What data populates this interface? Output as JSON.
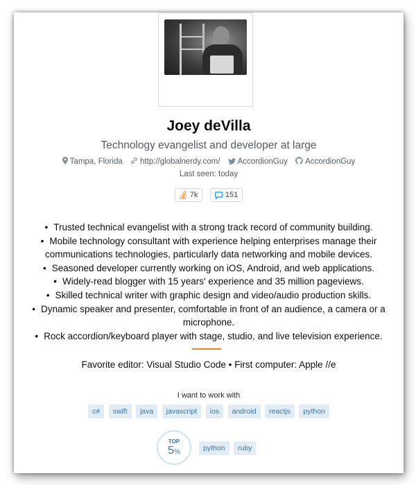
{
  "profile": {
    "name": "Joey deVilla",
    "tagline": "Technology evangelist and developer at large",
    "location": "Tampa, Florida",
    "website": "http://globalnerdy.com/",
    "twitter": "AccordionGuy",
    "github": "AccordionGuy",
    "last_seen": "Last seen: today"
  },
  "stats": {
    "reputation": "7k",
    "answers": "151"
  },
  "bullets": [
    "Trusted technical evangelist with a strong track record of community building.",
    "Mobile technology consultant with experience helping enterprises manage their communications technologies, particularly data networking and mobile devices.",
    "Seasoned developer currently working on iOS, Android, and web applications.",
    "Widely-read blogger with 15 years' experience and 35 million pageviews.",
    "Skilled technical writer with graphic design and video/audio production skills.",
    "Dynamic speaker and presenter, comfortable in front of an audience, a camera or a microphone.",
    "Rock accordion/keyboard player with stage, studio, and live television experience."
  ],
  "favorites": "Favorite editor: Visual Studio Code • First computer: Apple //e",
  "work": {
    "label": "I want to work with",
    "tags": [
      "c#",
      "swift",
      "java",
      "javascript",
      "ios",
      "android",
      "reactjs",
      "python"
    ]
  },
  "top": {
    "label": "TOP",
    "value": "5",
    "unit": "%",
    "tags": [
      "python",
      "ruby"
    ]
  },
  "icons": {
    "location": "map-pin-icon",
    "website": "link-icon",
    "twitter": "twitter-icon",
    "github": "github-icon",
    "reputation": "stack-overflow-icon",
    "answers": "speech-bubble-icon"
  },
  "colors": {
    "tag_bg": "#e1ecf4",
    "tag_text": "#39739d",
    "accent": "#f48024"
  }
}
